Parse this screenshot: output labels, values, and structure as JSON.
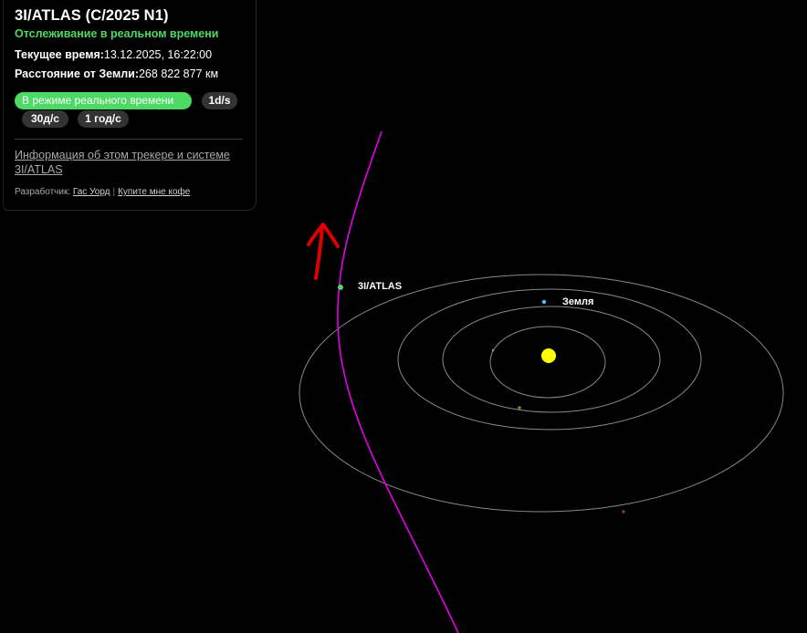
{
  "panel": {
    "title": "3I/ATLAS (C/2025 N1)",
    "subtitle": "Отслеживание в реальном времени",
    "current_time_label": "Текущее время:",
    "current_time_value": "13.12.2025, 16:22:00",
    "distance_label": "Расстояние от Земли:",
    "distance_value": "268 822 877 км",
    "speed_buttons": {
      "live": "В режиме реального времени",
      "one_day": "1d/s",
      "thirty_days": "30д/с",
      "one_year": "1 год/с"
    },
    "info_link": "Информация об этом трекере и системе 3I/ATLAS",
    "credits": {
      "prefix": "Разработчик:",
      "author_link": "Гас Уорд",
      "separator": "|",
      "coffee_link": "Купите мне кофе"
    }
  },
  "scene": {
    "labels": {
      "comet": "3I/ATLAS",
      "earth": "Земля"
    },
    "colors": {
      "background": "#000000",
      "orbit": "#8a8a8a",
      "trajectory": "#e600e6",
      "sun": "#ffff00",
      "comet": "#4cd964",
      "earth": "#4fc3f7",
      "mars": "#8b3a1a",
      "venus": "#6b8e23",
      "annotation_arrow": "#e00000",
      "accent_green": "#4cd964"
    }
  }
}
